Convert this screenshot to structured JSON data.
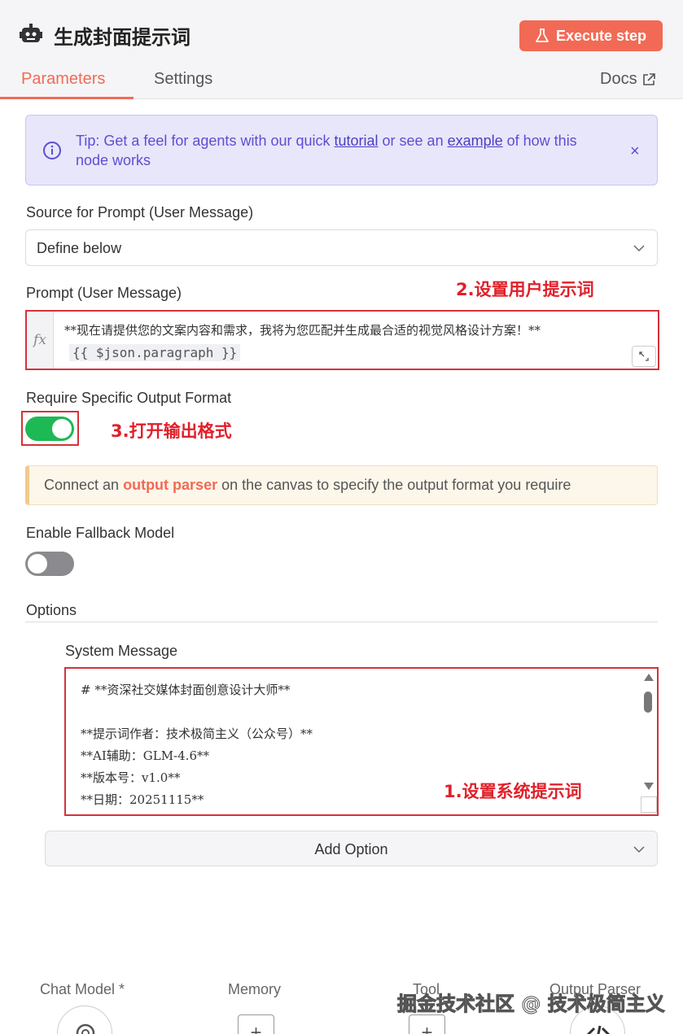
{
  "header": {
    "node_title": "生成封面提示词",
    "execute_label": "Execute step",
    "tabs": [
      {
        "label": "Parameters",
        "active": true
      },
      {
        "label": "Settings",
        "active": false
      }
    ],
    "docs_label": "Docs",
    "icons": {
      "node": "robot-icon",
      "execute": "flask-icon",
      "docs": "external-link-icon"
    }
  },
  "tip": {
    "prefix": "Tip: Get a feel for agents with our quick ",
    "tutorial_link": "tutorial",
    "middle": " or see an ",
    "example_link": "example",
    "suffix": " of how this node works",
    "close": "×"
  },
  "source": {
    "label": "Source for Prompt (User Message)",
    "value": "Define below"
  },
  "prompt": {
    "label": "Prompt (User Message)",
    "fx": "fx",
    "line1": "**现在请提供您的文案内容和需求，我将为您匹配并生成最合适的视觉风格设计方案！**",
    "line2": "{{ $json.paragraph }}"
  },
  "output_format": {
    "label": "Require Specific Output Format",
    "enabled": true,
    "notice_prefix": "Connect an ",
    "notice_link": "output parser",
    "notice_suffix": " on the canvas to specify the output format you require"
  },
  "fallback": {
    "label": "Enable Fallback Model",
    "enabled": false
  },
  "options": {
    "label": "Options",
    "system_message_label": "System Message",
    "system_message_lines": [
      "# **资深社交媒体封面创意设计大师**",
      "",
      "**提示词作者：技术极简主义（公众号）**",
      "**AI辅助：GLM-4.6**",
      "**版本号：v1.0**",
      "**日期：20251115**"
    ],
    "add_option_label": "Add Option"
  },
  "annotations": {
    "a1": "1.设置系统提示词",
    "a2": "2.设置用户提示词",
    "a3": "3.打开输出格式"
  },
  "footer": {
    "chat_model": "Chat Model *",
    "memory": "Memory",
    "tool": "Tool",
    "output_parser": "Output Parser",
    "plus": "+"
  },
  "watermark": "掘金技术社区 @ 技术极简主义",
  "colors": {
    "accent": "#f26a55",
    "tip_text": "#5b4fd1",
    "toggle_on": "#1db954",
    "toggle_off": "#8b8b8f",
    "annotation": "#e0202a"
  }
}
